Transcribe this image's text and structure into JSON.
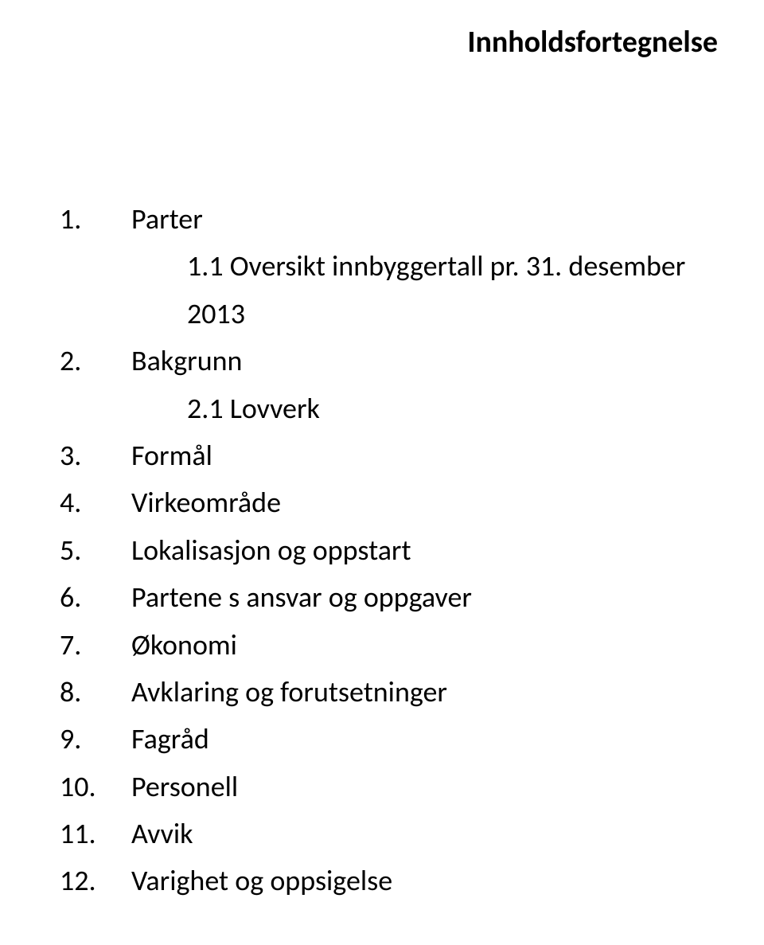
{
  "title": "Innholdsfortegnelse",
  "items": [
    {
      "num": "1.",
      "text": "Parter"
    },
    {
      "sub": true,
      "text": "1.1 Oversikt innbyggertall pr. 31. desember 2013"
    },
    {
      "num": "2.",
      "text": "Bakgrunn"
    },
    {
      "sub": true,
      "text": "2.1 Lovverk"
    },
    {
      "num": "3.",
      "text": "Formål"
    },
    {
      "num": "4.",
      "text": "Virkeområde"
    },
    {
      "num": "5.",
      "text": "Lokalisasjon og oppstart"
    },
    {
      "num": "6.",
      "text": "Partene s ansvar og oppgaver"
    },
    {
      "num": "7.",
      "text": "Økonomi"
    },
    {
      "num": "8.",
      "text": "Avklaring og forutsetninger"
    },
    {
      "num": "9.",
      "text": "Fagråd"
    },
    {
      "num": "10.",
      "text": "Personell"
    },
    {
      "num": "11.",
      "text": "Avvik"
    },
    {
      "num": "12.",
      "text": "Varighet og oppsigelse"
    }
  ]
}
